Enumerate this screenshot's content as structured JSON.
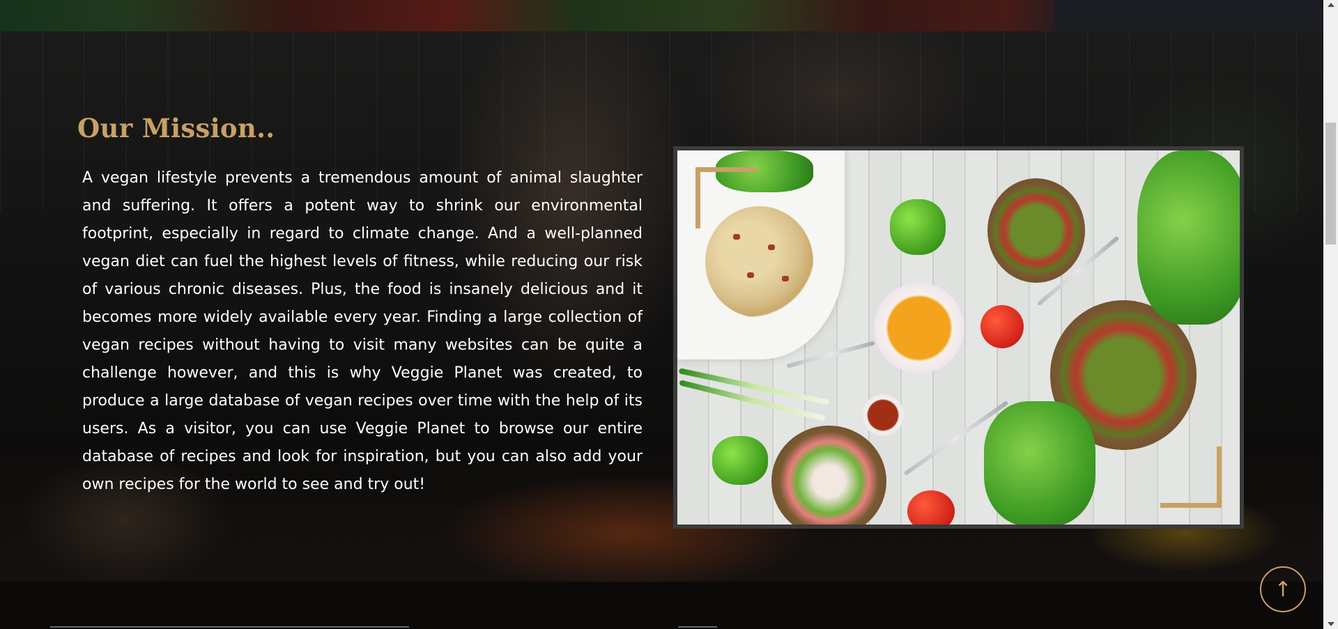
{
  "mission": {
    "heading": "Our Mission..",
    "body": "A vegan lifestyle prevents a tremendous amount of animal slaughter and suffering. It offers a potent way to shrink our environmental footprint, especially in regard to climate change. And a well-planned vegan diet can fuel the highest levels of fitness, while reducing our risk of various chronic diseases. Plus, the food is insanely delicious and it becomes more widely available every year. Finding a large collection of vegan recipes without having to visit many websites can be quite a challenge however, and this is why Veggie Planet was created, to produce a large database of vegan recipes over time with the help of its users. As a visitor, you can use Veggie Planet to browse our entire database of recipes and look for inspiration, but you can also add your own recipes for the world to see and try out!"
  },
  "back_to_top": {
    "icon": "arrow-up-icon",
    "glyph": "↑"
  },
  "colors": {
    "accent": "#c8a064",
    "text": "#ffffff",
    "background": "#0b0a09"
  }
}
